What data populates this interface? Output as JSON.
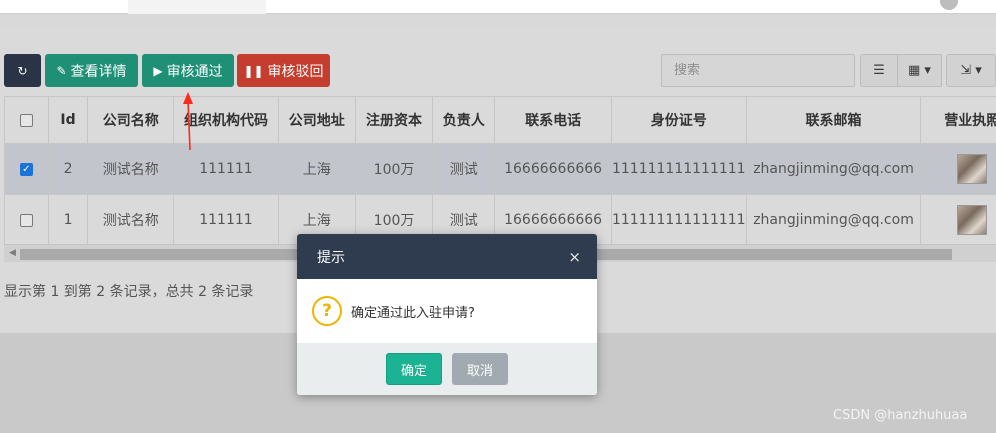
{
  "toolbar": {
    "detail_label": "查看详情",
    "pass_label": "审核通过",
    "reject_label": "审核驳回",
    "search_placeholder": "搜索"
  },
  "table": {
    "headers": [
      "Id",
      "公司名称",
      "组织机构代码",
      "公司地址",
      "注册资本",
      "负责人",
      "联系电话",
      "身份证号",
      "联系邮箱",
      "营业执照"
    ],
    "rows": [
      {
        "selected": true,
        "id": "2",
        "name": "测试名称",
        "org_code": "111111",
        "address": "上海",
        "capital": "100万",
        "owner": "测试",
        "phone": "16666666666",
        "id_card": "111111111111111",
        "email": "zhangjinming@qq.com"
      },
      {
        "selected": false,
        "id": "1",
        "name": "测试名称",
        "org_code": "111111",
        "address": "上海",
        "capital": "100万",
        "owner": "测试",
        "phone": "16666666666",
        "id_card": "111111111111111",
        "email": "zhangjinming@qq.com"
      }
    ]
  },
  "pagination": {
    "summary": "显示第 1 到第 2 条记录，总共 2 条记录"
  },
  "dialog": {
    "title": "提示",
    "close": "×",
    "message": "确定通过此入驻申请?",
    "ok_label": "确定",
    "cancel_label": "取消"
  },
  "watermark": "CSDN @hanzhuhuaa",
  "colors": {
    "dialog_header": "#2f3c4f",
    "ok_button": "#1bb394",
    "cancel_button": "#a1aab0",
    "warning_icon": "#f0b400"
  },
  "icons": {
    "refresh": "refresh-icon",
    "detail": "pencil-icon",
    "pass": "play-icon",
    "reject": "pause-icon",
    "list": "list-icon",
    "columns": "grid-icon",
    "export": "export-icon",
    "question": "question-icon"
  }
}
